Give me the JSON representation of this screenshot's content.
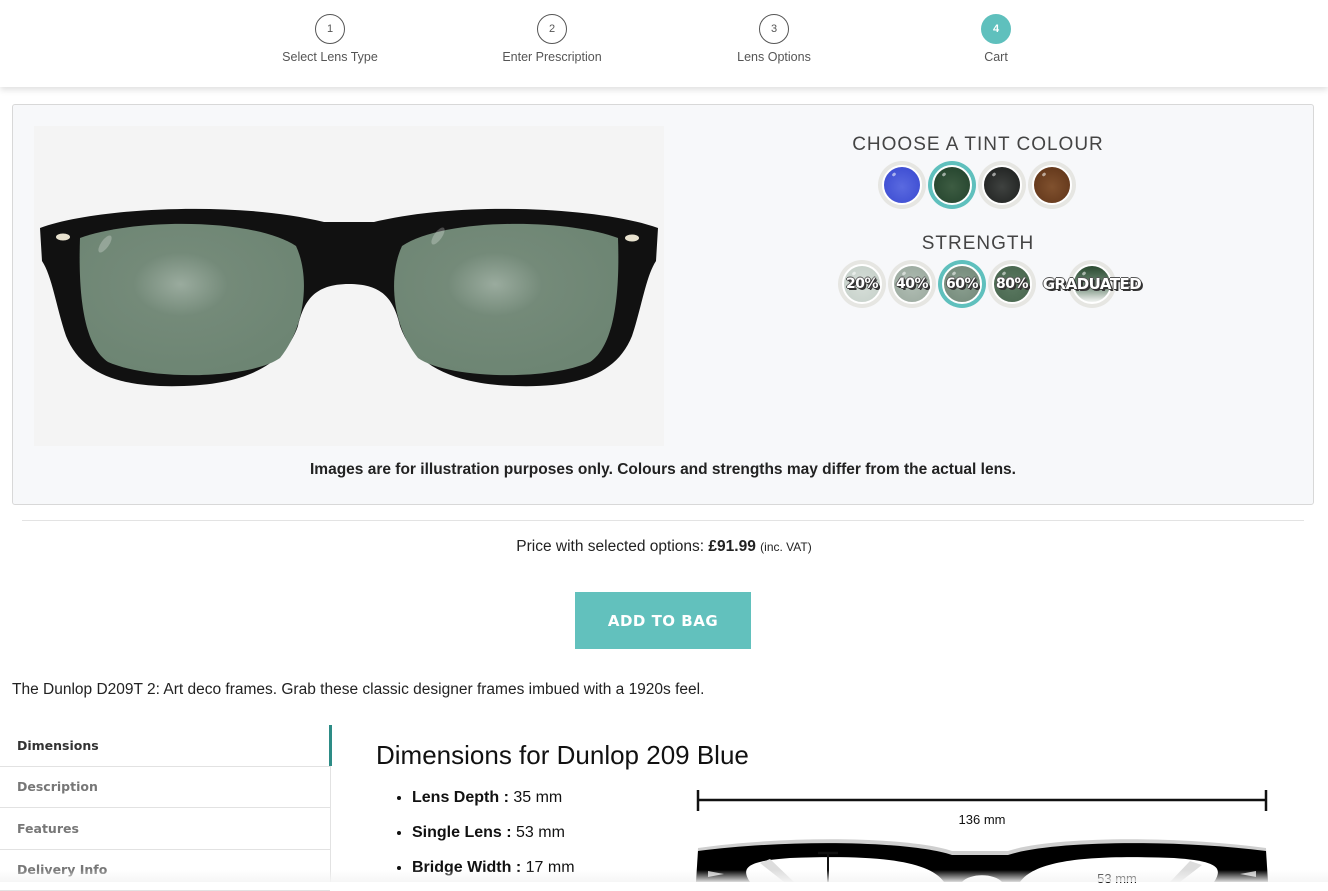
{
  "stepper": {
    "steps": [
      {
        "number": "1",
        "label": "Select Lens Type",
        "active": false
      },
      {
        "number": "2",
        "label": "Enter Prescription",
        "active": false
      },
      {
        "number": "3",
        "label": "Lens Options",
        "active": false
      },
      {
        "number": "4",
        "label": "Cart",
        "active": true
      }
    ]
  },
  "options": {
    "tint_heading": "CHOOSE A TINT COLOUR",
    "tints": [
      {
        "name": "Blue",
        "color": "#3e50d6",
        "selected": false
      },
      {
        "name": "Green",
        "color": "#2a4a30",
        "selected": true
      },
      {
        "name": "Grey",
        "color": "#232524",
        "selected": false
      },
      {
        "name": "Brown",
        "color": "#6b3a1c",
        "selected": false
      }
    ],
    "strength_heading": "STRENGTH",
    "strengths": [
      {
        "label": "20%",
        "color": "#c9d3cc",
        "selected": false
      },
      {
        "label": "40%",
        "color": "#a0aea4",
        "selected": false
      },
      {
        "label": "60%",
        "color": "#7a9080",
        "selected": true
      },
      {
        "label": "80%",
        "color": "#4c6a52",
        "selected": false
      },
      {
        "label": "GRADUATED",
        "color": "#2f5034",
        "selected": false
      }
    ],
    "disclaimer": "Images are for illustration purposes only. Colours and strengths may differ from the actual lens."
  },
  "price": {
    "label": "Price with selected options:",
    "amount": "£91.99",
    "vat_note": "(inc. VAT)"
  },
  "add_to_bag_label": "ADD TO BAG",
  "accent_color": "#62c1bd",
  "product_description": "The Dunlop D209T 2: Art deco frames. Grab these classic designer frames imbued with a 1920s feel.",
  "tabs": [
    {
      "label": "Dimensions",
      "active": true
    },
    {
      "label": "Description",
      "active": false
    },
    {
      "label": "Features",
      "active": false
    },
    {
      "label": "Delivery Info",
      "active": false
    }
  ],
  "dimensions": {
    "title": "Dimensions for Dunlop 209 Blue",
    "items": [
      {
        "key": "Lens Depth :",
        "value": "35 mm"
      },
      {
        "key": "Single Lens :",
        "value": "53 mm"
      },
      {
        "key": "Bridge Width :",
        "value": "17 mm"
      }
    ],
    "diagram": {
      "total_width_label": "136 mm",
      "lens_width_label": "53 mm"
    }
  }
}
